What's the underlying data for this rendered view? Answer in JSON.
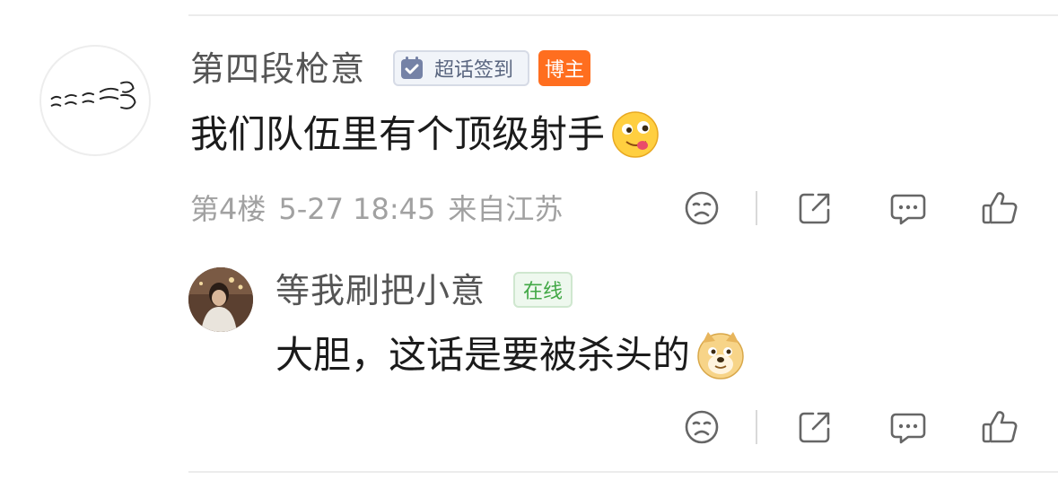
{
  "comment": {
    "author": "第四段枪意",
    "badge_checkin": "超话签到",
    "badge_role": "博主",
    "text": "我们队伍里有个顶级射手",
    "emoji": "tongue-out-emoji",
    "floor": "第4楼",
    "time": "5-27 18:45",
    "location": "来自江苏"
  },
  "reply": {
    "author": "等我刷把小意",
    "status_badge": "在线",
    "text": "大胆，这话是要被杀头的",
    "emoji": "doge-emoji"
  },
  "actions": [
    "dislike-icon",
    "share-icon",
    "comment-icon",
    "like-icon"
  ],
  "colors": {
    "blogger_badge": "#ff6e1f",
    "online_badge": "#41a845",
    "meta_text": "#a1a1a1"
  }
}
